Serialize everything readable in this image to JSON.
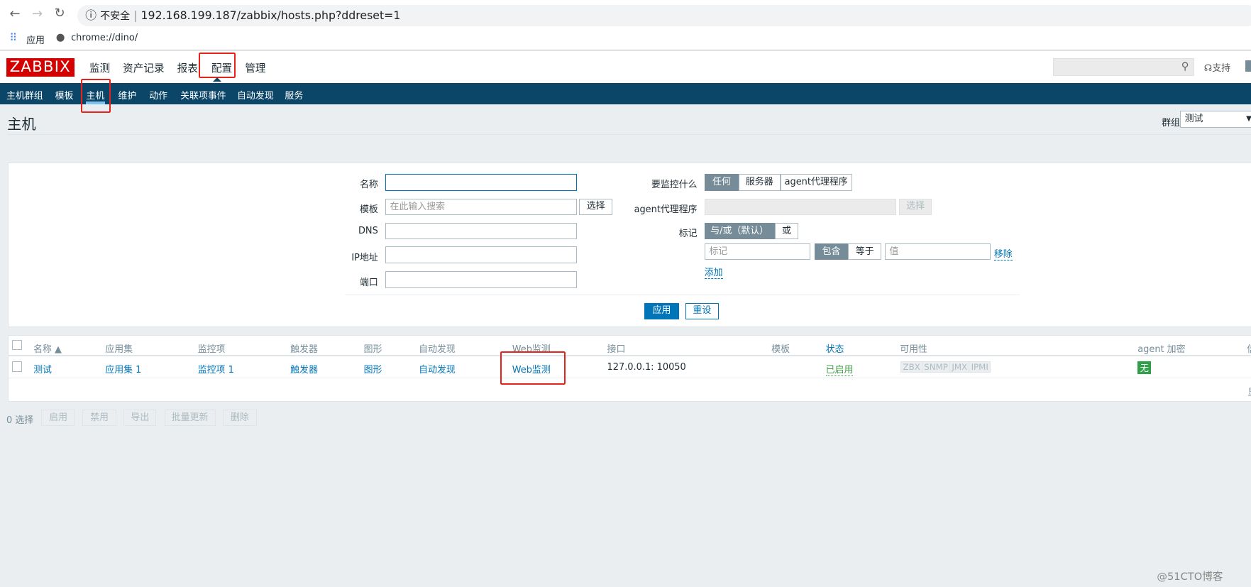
{
  "browser": {
    "insecure": "不安全",
    "url": "192.168.199.187/zabbix/hosts.php?ddreset=1",
    "bookmarks": [
      "应用",
      "chrome://dino/"
    ]
  },
  "header": {
    "logo": "ZABBIX",
    "nav": [
      "监测",
      "资产记录",
      "报表",
      "配置",
      "管理"
    ],
    "support": "支持"
  },
  "subnav": [
    "主机群组",
    "模板",
    "主机",
    "维护",
    "动作",
    "关联项事件",
    "自动发现",
    "服务"
  ],
  "page": {
    "title": "主机",
    "group_label": "群组",
    "group_value": "测试"
  },
  "filter": {
    "name_label": "名称",
    "template_label": "模板",
    "template_placeholder": "在此输入搜索",
    "select": "选择",
    "dns_label": "DNS",
    "ip_label": "IP地址",
    "port_label": "端口",
    "monitored_label": "要监控什么",
    "monitored_options": [
      "任何",
      "服务器",
      "agent代理程序"
    ],
    "proxy_label": "agent代理程序",
    "tags_label": "标记",
    "tag_ops": [
      "与/或（默认）",
      "或"
    ],
    "tag_placeholder": "标记",
    "tag_match": [
      "包含",
      "等于"
    ],
    "value_placeholder": "值",
    "remove": "移除",
    "add": "添加",
    "apply": "应用",
    "reset": "重设"
  },
  "table": {
    "headers": [
      "名称 ▲",
      "应用集",
      "监控项",
      "触发器",
      "图形",
      "自动发现",
      "Web监测",
      "接口",
      "模板",
      "状态",
      "可用性",
      "agent 加密",
      "信"
    ],
    "row": {
      "name": "测试",
      "apps": "应用集 1",
      "items": "监控项 1",
      "triggers": "触发器",
      "graphs": "图形",
      "discovery": "自动发现",
      "web": "Web监测",
      "interface": "127.0.0.1: 10050",
      "status": "已启用",
      "availability": [
        "ZBX",
        "SNMP",
        "JMX",
        "IPMI"
      ],
      "encryption": "无"
    },
    "footer": "显"
  },
  "actions": {
    "selected": "0 选择",
    "buttons": [
      "启用",
      "禁用",
      "导出",
      "批量更新",
      "删除"
    ]
  },
  "watermark": "@51CTO博客",
  "colors": {
    "brand": "#d40000",
    "subnav": "#0b4669",
    "link": "#0275b8",
    "enabled": "#429e47",
    "highlight": "#e8221b"
  }
}
